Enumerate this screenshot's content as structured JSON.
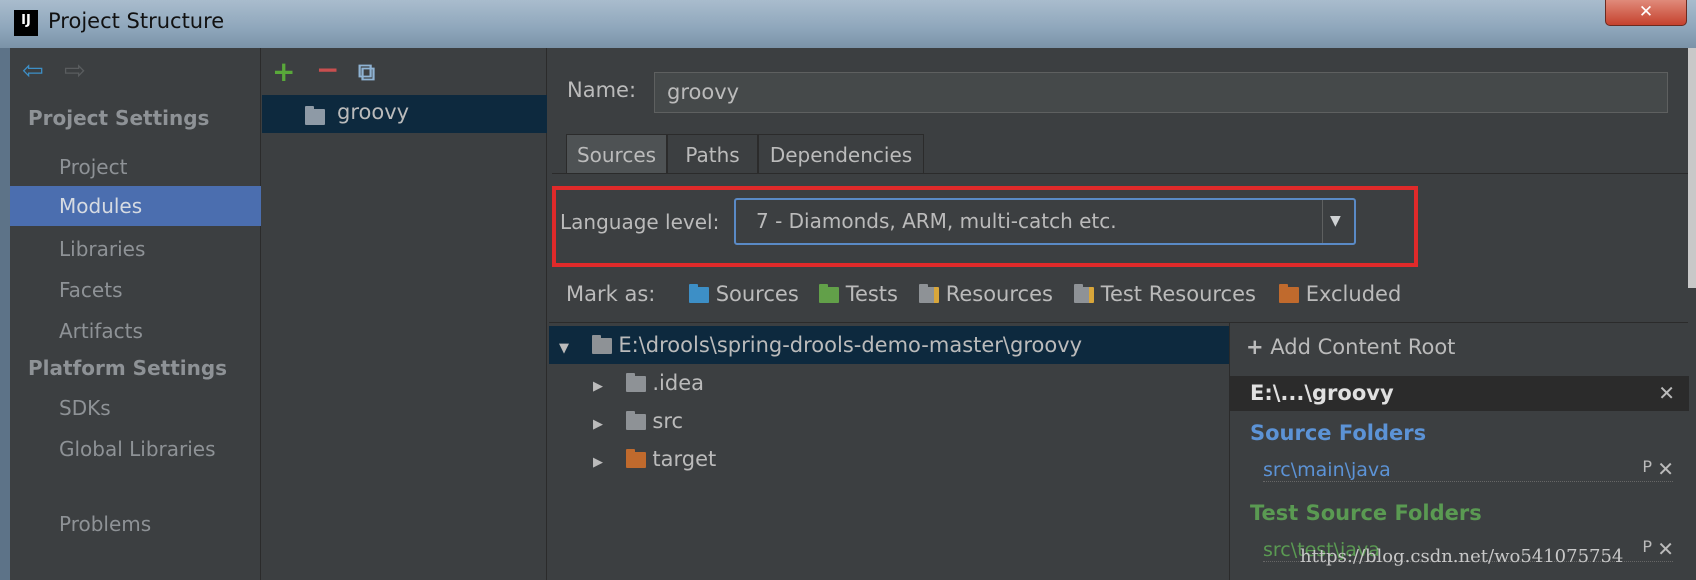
{
  "window": {
    "title": "Project Structure",
    "logo": "IJ",
    "close": "✕"
  },
  "sidebar": {
    "groups": [
      {
        "label": "Project Settings"
      },
      {
        "label": "Platform Settings"
      }
    ],
    "items": [
      {
        "label": "Project"
      },
      {
        "label": "Modules",
        "selected": true
      },
      {
        "label": "Libraries"
      },
      {
        "label": "Facets"
      },
      {
        "label": "Artifacts"
      },
      {
        "label": "SDKs"
      },
      {
        "label": "Global Libraries"
      },
      {
        "label": "Problems"
      }
    ]
  },
  "module_list": {
    "modules": [
      {
        "label": "groovy"
      }
    ]
  },
  "name": {
    "label": "Name:",
    "value": "groovy"
  },
  "tabs": [
    {
      "label": "Sources",
      "selected": true
    },
    {
      "label": "Paths"
    },
    {
      "label": "Dependencies"
    }
  ],
  "language_level": {
    "label": "Language level:",
    "value": "7 - Diamonds, ARM, multi-catch etc."
  },
  "mark_as": {
    "label": "Mark as:",
    "items": [
      {
        "label": "Sources",
        "color": "#3d8fc6"
      },
      {
        "label": "Tests",
        "color": "#62a049"
      },
      {
        "label": "Resources",
        "color": "#8e9296"
      },
      {
        "label": "Test Resources",
        "color": "#8e9296"
      },
      {
        "label": "Excluded",
        "color": "#c06a2d"
      }
    ]
  },
  "tree": {
    "root": "E:\\drools\\spring-drools-demo-master\\groovy",
    "children": [
      {
        "label": ".idea"
      },
      {
        "label": "src"
      },
      {
        "label": "target"
      }
    ]
  },
  "content_roots": {
    "add_label": "Add Content Root",
    "root": "E:\\...\\groovy",
    "source_folders_label": "Source Folders",
    "source_folders": [
      "src\\main\\java"
    ],
    "test_folders_label": "Test Source Folders",
    "test_folders": [
      "src\\test\\java"
    ],
    "props_label": "P"
  },
  "watermark": "https://blog.csdn.net/wo541075754"
}
